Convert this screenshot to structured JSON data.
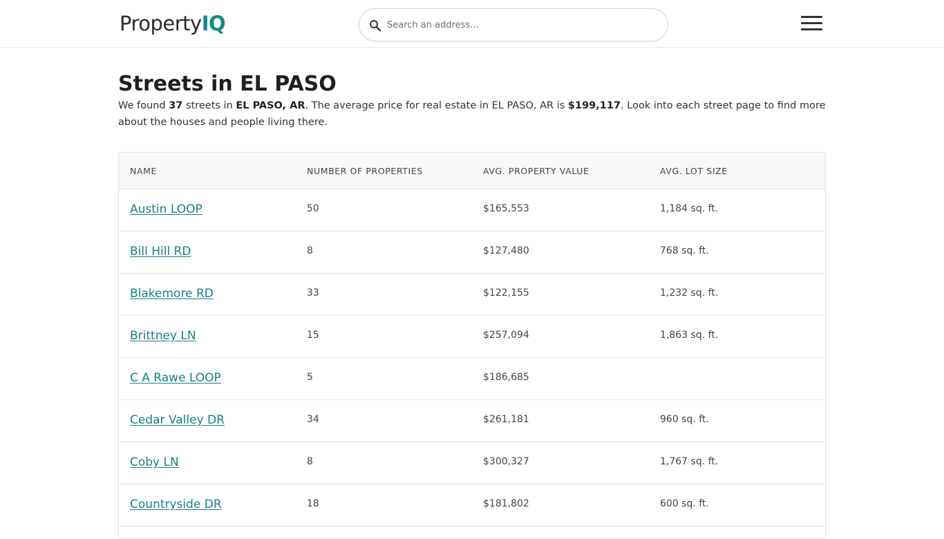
{
  "header": {
    "logo_prefix": "Property",
    "logo_suffix": "IQ",
    "search_placeholder": "Search an address..."
  },
  "page": {
    "title": "Streets in EL PASO",
    "intro": {
      "t1": "We found ",
      "count": "37",
      "t2": " streets in ",
      "location": "EL PASO, AR",
      "t3": ". The average price for real estate in EL PASO, AR is ",
      "avg_price": "$199,117",
      "t4": ". Look into each street page to find more about the houses and people living there."
    }
  },
  "table": {
    "columns": [
      "NAME",
      "NUMBER OF PROPERTIES",
      "AVG. PROPERTY VALUE",
      "AVG. LOT SIZE"
    ],
    "rows": [
      {
        "name": "Austin LOOP",
        "properties": "50",
        "value": "$165,553",
        "lot": "1,184 sq. ft."
      },
      {
        "name": "Bill Hill RD",
        "properties": "8",
        "value": "$127,480",
        "lot": "768 sq. ft."
      },
      {
        "name": "Blakemore RD",
        "properties": "33",
        "value": "$122,155",
        "lot": "1,232 sq. ft."
      },
      {
        "name": "Brittney LN",
        "properties": "15",
        "value": "$257,094",
        "lot": "1,863 sq. ft."
      },
      {
        "name": "C A Rawe LOOP",
        "properties": "5",
        "value": "$186,685",
        "lot": ""
      },
      {
        "name": "Cedar Valley DR",
        "properties": "34",
        "value": "$261,181",
        "lot": "960 sq. ft."
      },
      {
        "name": "Coby LN",
        "properties": "8",
        "value": "$300,327",
        "lot": "1,767 sq. ft."
      },
      {
        "name": "Countryside DR",
        "properties": "18",
        "value": "$181,802",
        "lot": "600 sq. ft."
      }
    ]
  },
  "colors": {
    "brand_teal": "#138a8a",
    "link": "#167f86"
  }
}
